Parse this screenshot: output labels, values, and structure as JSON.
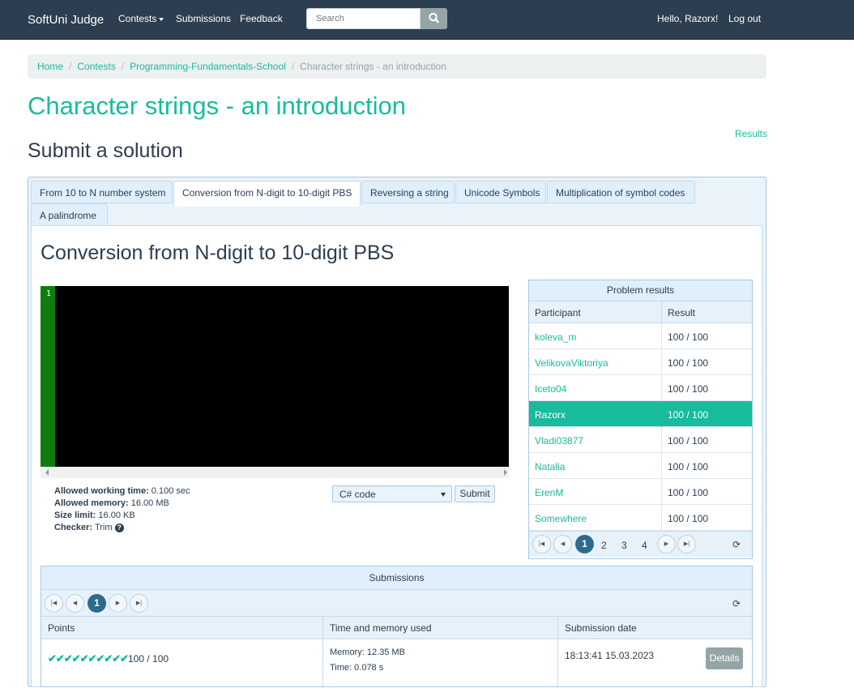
{
  "navbar": {
    "brand": "SoftUni Judge",
    "contests": "Contests",
    "submissions": "Submissions",
    "feedback": "Feedback",
    "search_placeholder": "Search",
    "greeting": "Hello, Razorx!",
    "logout": "Log out"
  },
  "breadcrumb": [
    "Home",
    "Contests",
    "Programming-Fundamentals-School",
    "Character strings - an introduction"
  ],
  "page_title": "Character strings - an introduction",
  "results_link": "Results",
  "sub_title": "Submit a solution",
  "tabs": [
    "From 10 to N number system",
    "Conversion from N-digit to 10-digit PBS",
    "Reversing a string",
    "Unicode Symbols",
    "Multiplication of symbol codes",
    "A palindrome"
  ],
  "task_title": "Conversion from N-digit to 10-digit PBS",
  "editor": {
    "line": "1"
  },
  "limits": {
    "time_label": "Allowed working time:",
    "time": "0.100 sec",
    "memory_label": "Allowed memory:",
    "memory": "16.00 MB",
    "size_label": "Size limit:",
    "size": "16.00 KB",
    "checker_label": "Checker:",
    "checker": "Trim"
  },
  "language": "C# code",
  "submit": "Submit",
  "problem_results": {
    "title": "Problem results",
    "col_participant": "Participant",
    "col_result": "Result",
    "rows": [
      {
        "name": "koleva_m",
        "result": "100 / 100"
      },
      {
        "name": "VelikovaViktoriya",
        "result": "100 / 100"
      },
      {
        "name": "Iceto04",
        "result": "100 / 100"
      },
      {
        "name": "Razorx",
        "result": "100 / 100"
      },
      {
        "name": "Vladi03877",
        "result": "100 / 100"
      },
      {
        "name": "Natalia",
        "result": "100 / 100"
      },
      {
        "name": "ErenM",
        "result": "100 / 100"
      },
      {
        "name": "Somewhere",
        "result": "100 / 100"
      }
    ],
    "pages": [
      "1",
      "2",
      "3",
      "4"
    ]
  },
  "submissions": {
    "title": "Submissions",
    "page": "1",
    "col_points": "Points",
    "col_time_memory": "Time and memory used",
    "col_date": "Submission date",
    "row": {
      "ticks": "✔✔✔✔✔✔✔✔✔✔",
      "points": "100 / 100",
      "memory": "Memory: 12.35 MB",
      "time": "Time: 0.078 s",
      "date": "18:13:41 15.03.2023",
      "details": "Details"
    }
  },
  "colors": {
    "navbar": "#2c3e50",
    "accent": "#18bc9c",
    "active_page": "#2e6a8e"
  }
}
